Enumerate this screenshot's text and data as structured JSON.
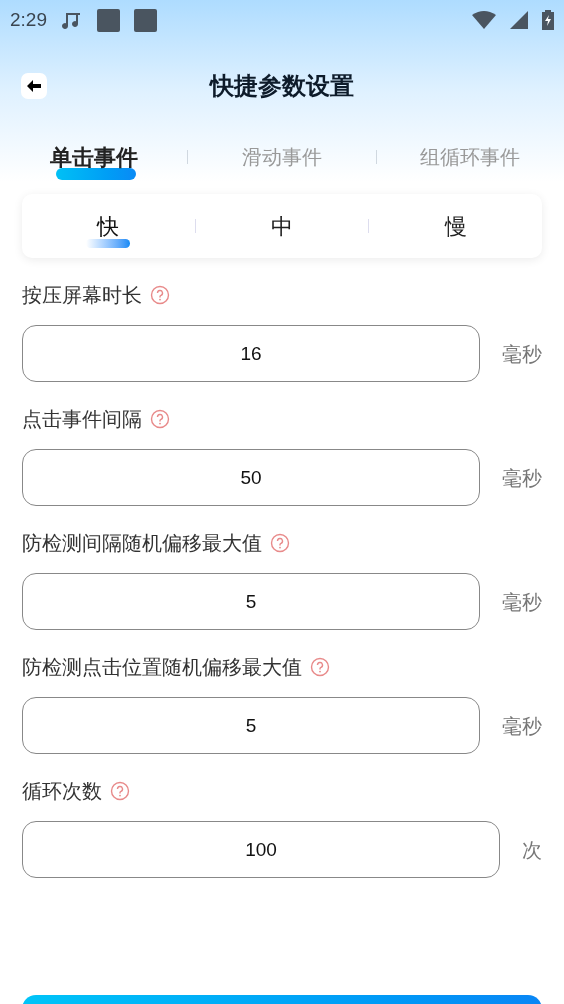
{
  "status_bar": {
    "time": "2:29"
  },
  "header": {
    "title": "快捷参数设置"
  },
  "tabs": [
    {
      "label": "单击事件",
      "selected": true
    },
    {
      "label": "滑动事件",
      "selected": false
    },
    {
      "label": "组循环事件",
      "selected": false
    }
  ],
  "speed": [
    {
      "label": "快",
      "selected": true
    },
    {
      "label": "中",
      "selected": false
    },
    {
      "label": "慢",
      "selected": false
    }
  ],
  "fields": [
    {
      "label": "按压屏幕时长",
      "value": "16",
      "unit": "毫秒"
    },
    {
      "label": "点击事件间隔",
      "value": "50",
      "unit": "毫秒"
    },
    {
      "label": "防检测间隔随机偏移最大值",
      "value": "5",
      "unit": "毫秒"
    },
    {
      "label": "防检测点击位置随机偏移最大值",
      "value": "5",
      "unit": "毫秒"
    },
    {
      "label": "循环次数",
      "value": "100",
      "unit": "次"
    }
  ]
}
